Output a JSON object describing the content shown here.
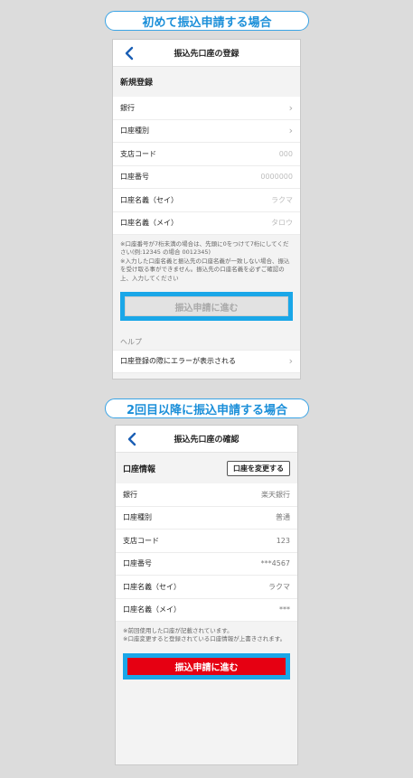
{
  "first": {
    "pill": "初めて振込申請する場合",
    "title": "振込先口座の登録",
    "section": "新規登録",
    "rows": [
      {
        "label": "銀行",
        "value": ""
      },
      {
        "label": "口座種別",
        "value": ""
      },
      {
        "label": "支店コード",
        "value": "000"
      },
      {
        "label": "口座番号",
        "value": "0000000"
      },
      {
        "label": "口座名義（セイ）",
        "value": "ラクマ"
      },
      {
        "label": "口座名義（メイ）",
        "value": "タロウ"
      }
    ],
    "notes": [
      "※口座番号が7桁未満の場合は、先頭に0をつけて7桁にしてください(例:12345 の場合 0012345)",
      "※入力した口座名義と振込先の口座名義が一致しない場合、振込を受け取る事ができません。振込先の口座名義を必ずご確認の上、入力してください"
    ],
    "button": "振込申請に進む",
    "help_label": "ヘルプ",
    "help_item": "口座登録の際にエラーが表示される"
  },
  "second": {
    "pill": "2回目以降に振込申請する場合",
    "title": "振込先口座の確認",
    "section": "口座情報",
    "change_button": "口座を変更する",
    "rows": [
      {
        "label": "銀行",
        "value": "楽天銀行"
      },
      {
        "label": "口座種別",
        "value": "普通"
      },
      {
        "label": "支店コード",
        "value": "123"
      },
      {
        "label": "口座番号",
        "value": "***4567"
      },
      {
        "label": "口座名義（セイ）",
        "value": "ラクマ"
      },
      {
        "label": "口座名義（メイ）",
        "value": "***"
      }
    ],
    "notes": [
      "※前回使用した口座が記載されています。",
      "※口座変更すると登録されている口座情報が上書きされます。"
    ],
    "button": "振込申請に進む"
  },
  "colors": {
    "accent_blue": "#1aa7e8",
    "back_arrow": "#1b5fb5",
    "submit_red": "#e60012",
    "submit_disabled": "#e2e2e2"
  },
  "icons": {
    "back": "chevron-left-icon",
    "row_arrow": "chevron-right-icon"
  }
}
